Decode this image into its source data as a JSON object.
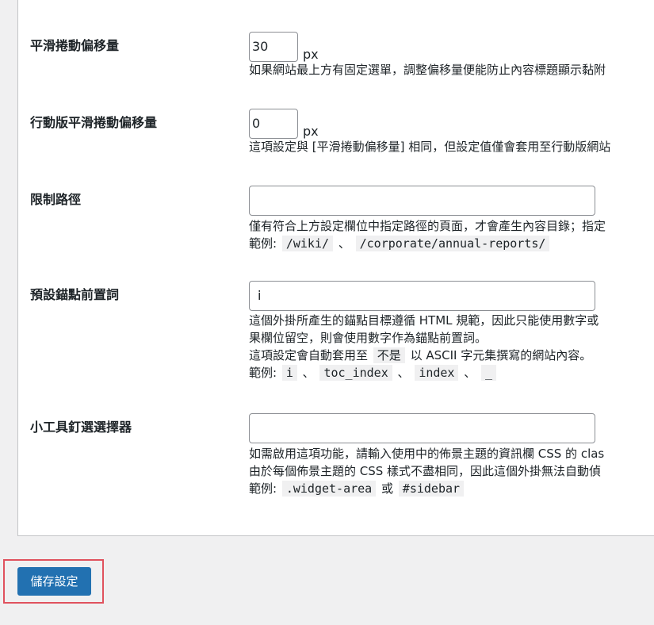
{
  "settings": {
    "scroll_offset": {
      "label": "平滑捲動偏移量",
      "value": "30",
      "unit": "px",
      "desc_lines": [
        "如果網站最上方有固定選單，調整偏移量便能防止內容標題顯示黏附"
      ]
    },
    "mobile_scroll_offset": {
      "label": "行動版平滑捲動偏移量",
      "value": "0",
      "unit": "px",
      "desc_lines": [
        "這項設定與 [平滑捲動偏移量] 相同，但設定值僅會套用至行動版網站"
      ]
    },
    "limit_path": {
      "label": "限制路徑",
      "value": "",
      "desc_lines": [
        "僅有符合上方設定欄位中指定路徑的頁面，才會產生內容目錄；指定"
      ],
      "example_prefix": "範例:",
      "example_codes": [
        "/wiki/",
        "/corporate/annual-reports/"
      ],
      "example_sep": "、"
    },
    "anchor_prefix": {
      "label": "預設錨點前置詞",
      "value": "i",
      "desc_lines": [
        "這個外掛所產生的錨點目標遵循 HTML 規範，因此只能使用數字或",
        "果欄位留空，則會使用數字作為錨點前置詞。"
      ],
      "desc_line3_before": "這項設定會自動套用至",
      "desc_line3_code": "不是",
      "desc_line3_after": "以 ASCII 字元集撰寫的網站內容。",
      "example_prefix": "範例:",
      "example_codes": [
        "i",
        "toc_index",
        "index",
        "_"
      ],
      "example_sep": "、"
    },
    "widget_selector": {
      "label": "小工具釘選選擇器",
      "value": "",
      "desc_lines": [
        "如需啟用這項功能，請輸入使用中的佈景主題的資訊欄 CSS 的 clas",
        "由於每個佈景主題的 CSS 樣式不盡相同，因此這個外掛無法自動偵"
      ],
      "example_prefix": "範例:",
      "example_codes": [
        ".widget-area",
        "#sidebar"
      ],
      "example_sep": "或"
    }
  },
  "footer": {
    "save_label": "儲存設定"
  },
  "colors": {
    "primary": "#2271b1",
    "highlight_border": "#e0525e",
    "background": "#f0f0f1"
  }
}
